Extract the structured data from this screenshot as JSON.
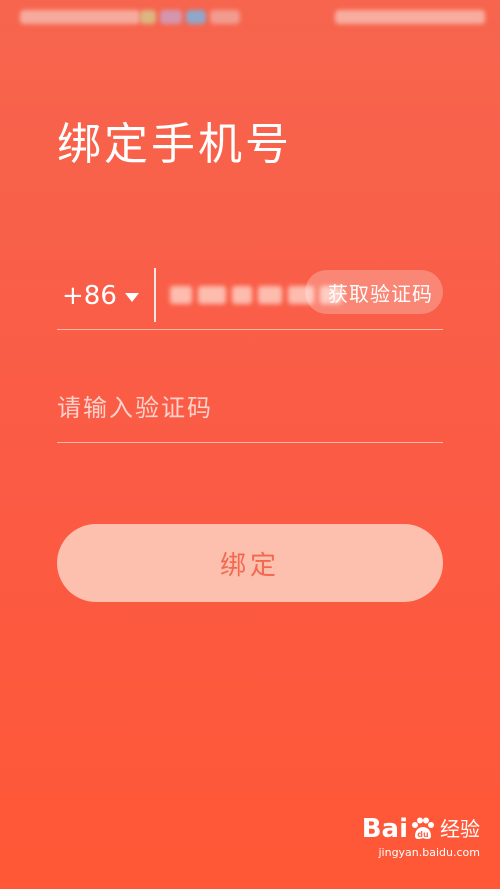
{
  "header": {
    "title": "绑定手机号"
  },
  "phone": {
    "country_code": "+86",
    "get_code_label": "获取验证码"
  },
  "verification": {
    "placeholder": "请输入验证码",
    "value": ""
  },
  "actions": {
    "bind_label": "绑定"
  },
  "watermark": {
    "brand_left": "Bai",
    "brand_right": "经验",
    "url": "jingyan.baidu.com"
  },
  "colors": {
    "background_top": "#f7654e",
    "background_bottom": "#ff5836",
    "button_fill": "#fdbfae",
    "button_text": "#f2694f"
  }
}
